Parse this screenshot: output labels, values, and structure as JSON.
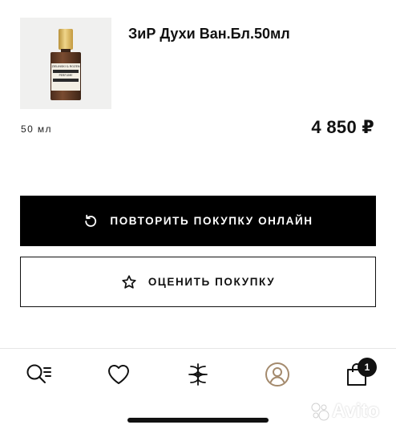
{
  "product": {
    "title": "ЗиР Духи Ван.Бл.50мл",
    "volume": "50 мл",
    "price": "4 850 ₽",
    "image_icon": "perfume-bottle-image",
    "label_text": "ZIELINSKI & ROZEN",
    "label_sub": "PERFUME"
  },
  "actions": {
    "repeat_label": "ПОВТОРИТЬ ПОКУПКУ ОНЛАЙН",
    "repeat_icon": "repeat-icon",
    "rate_label": "ОЦЕНИТЬ ПОКУПКУ",
    "rate_icon": "star-icon"
  },
  "tabbar": {
    "items": [
      {
        "icon": "search-list-icon"
      },
      {
        "icon": "heart-icon"
      },
      {
        "icon": "brand-logo-icon"
      },
      {
        "icon": "profile-icon",
        "active_color": "#a48a6d"
      },
      {
        "icon": "shopping-bag-icon"
      }
    ],
    "cart_badge": "1"
  },
  "watermark": {
    "text": "Avito"
  },
  "colors": {
    "primary": "#000000",
    "background": "#ffffff",
    "profile_accent": "#a48a6d"
  }
}
